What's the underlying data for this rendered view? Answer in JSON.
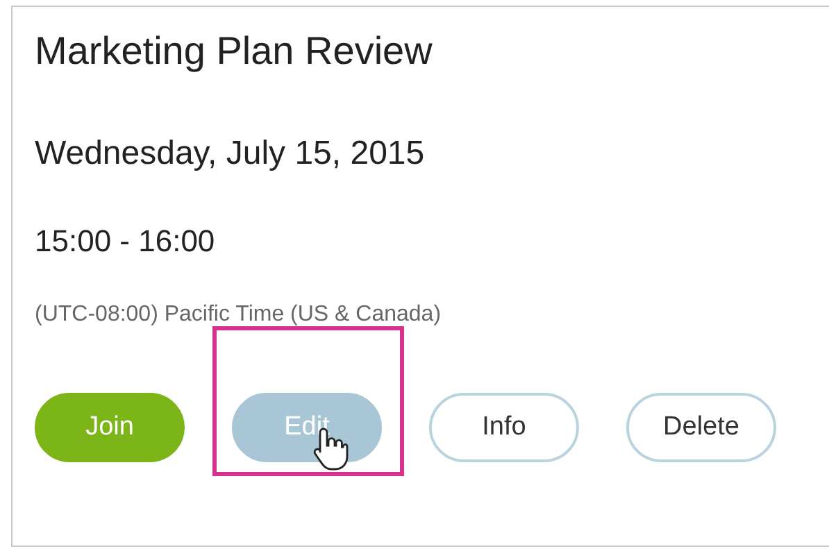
{
  "meeting": {
    "title": "Marketing Plan Review",
    "date": "Wednesday, July 15, 2015",
    "time": "15:00 - 16:00",
    "timezone": "(UTC-08:00) Pacific Time (US & Canada)"
  },
  "buttons": [
    {
      "label": "Join",
      "kind": "primary",
      "highlighted": false
    },
    {
      "label": "Edit",
      "kind": "pressed",
      "highlighted": true
    },
    {
      "label": "Info",
      "kind": "outline",
      "highlighted": false
    },
    {
      "label": "Delete",
      "kind": "outline",
      "highlighted": false
    }
  ]
}
